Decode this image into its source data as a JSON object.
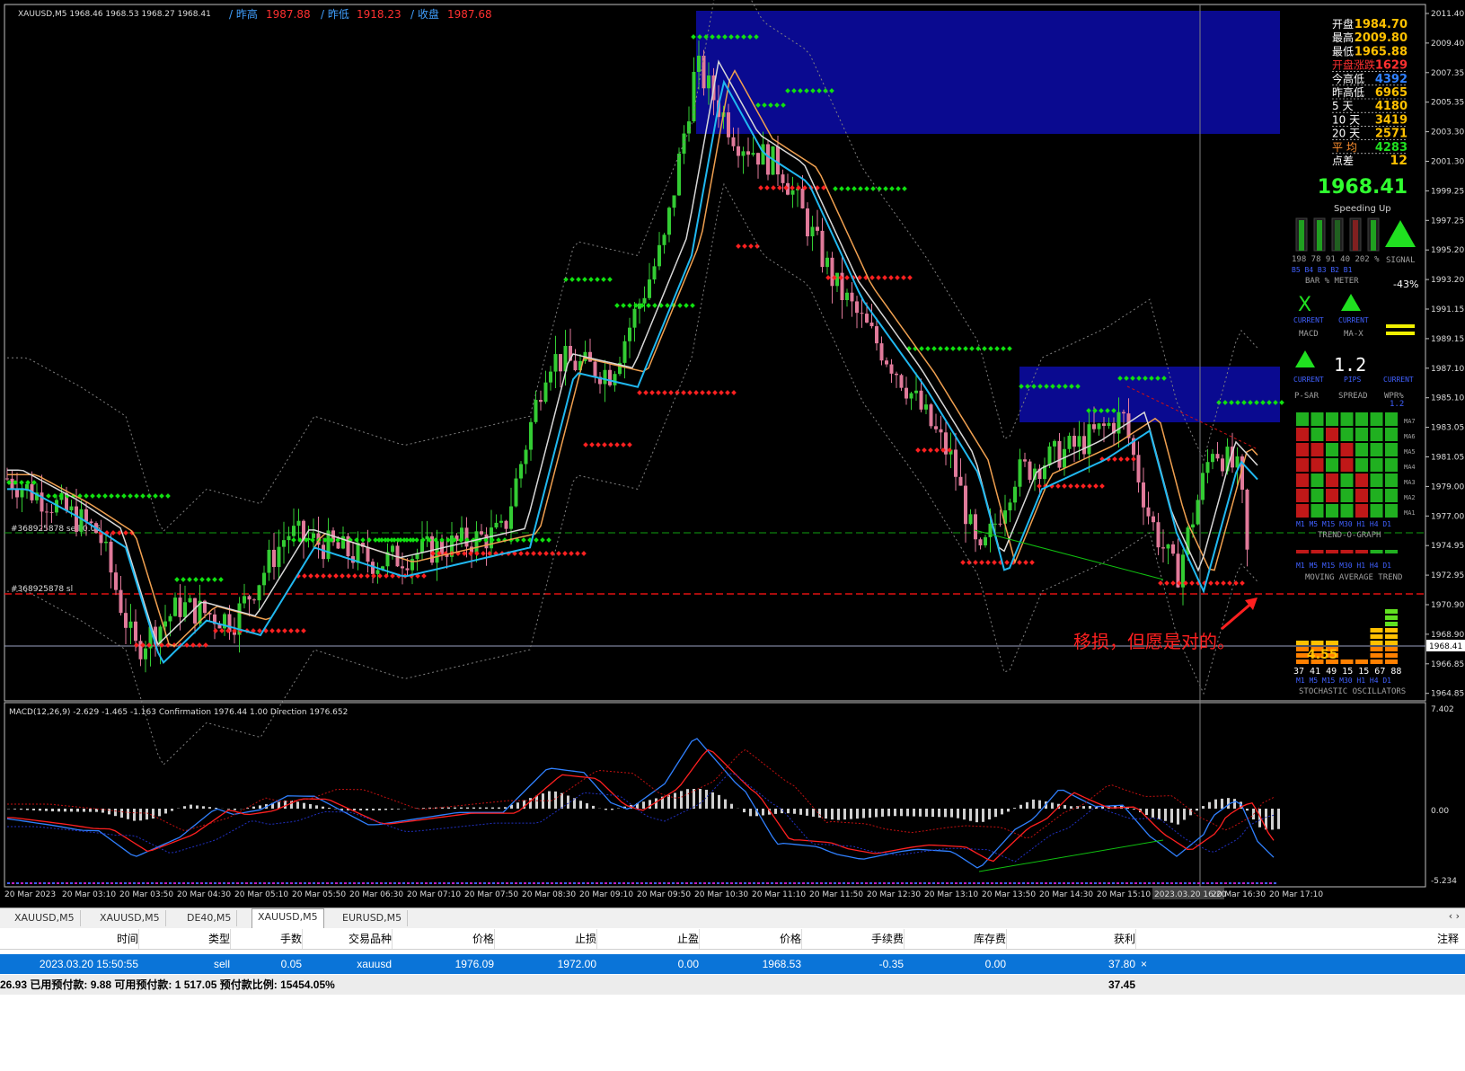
{
  "chart": {
    "symbol_info": "XAUUSD,M5  1968.46 1968.53 1968.27 1968.41",
    "prev_high_label": "/ 昨高",
    "prev_high_value": "1987.88",
    "prev_low_label": "/ 昨低",
    "prev_low_value": "1918.23",
    "close_label": "/ 收盘",
    "close_value": "1987.68",
    "colors": {
      "bull": "#33cc33",
      "bear": "#e07a9a",
      "ma_white": "#d8d8d8",
      "ma_orange": "#f0a050",
      "ma_cyan": "#20b8f0",
      "blue_zone": "#0a0a90",
      "red_dot": "#ff2020",
      "green_dot": "#10e010"
    },
    "price_scale": [
      "2011.40",
      "2009.40",
      "2007.35",
      "2005.35",
      "2003.30",
      "2001.30",
      "1999.25",
      "1997.25",
      "1995.20",
      "1993.20",
      "1991.15",
      "1989.15",
      "1987.10",
      "1985.10",
      "1983.05",
      "1981.05",
      "1979.00",
      "1977.00",
      "1974.95",
      "1972.95",
      "1970.90",
      "1968.90",
      "1966.85",
      "1964.85"
    ],
    "current_price_tag": "1968.41",
    "sl_line_label": "#368925878 sl",
    "sell_line_label": "#368925878 sell 0.05",
    "annotation": "移损，但愿是对的。",
    "time_axis": [
      "20 Mar 2023",
      "20 Mar 03:10",
      "20 Mar 03:50",
      "20 Mar 04:30",
      "20 Mar 05:10",
      "20 Mar 05:50",
      "20 Mar 06:30",
      "20 Mar 07:10",
      "20 Mar 07:50",
      "20 Mar 08:30",
      "20 Mar 09:10",
      "20 Mar 09:50",
      "20 Mar 10:30",
      "20 Mar 11:10",
      "20 Mar 11:50",
      "20 Mar 12:30",
      "20 Mar 13:10",
      "20 Mar 13:50",
      "20 Mar 14:30",
      "20 Mar 15:10",
      "2023.03.20 16:20",
      "20 Mar 16:30",
      "20 Mar 17:10"
    ],
    "macd_label": "MACD(12,26,9) -2.629 -1.465 -1.163  Confirmation 1976.44 1.00  Direction 1976.652",
    "macd_scale": [
      "7.402",
      "0.00",
      "-5.234"
    ]
  },
  "info_panel": {
    "rows": [
      {
        "label": "开盘",
        "value": "1984.70"
      },
      {
        "label": "最高",
        "value": "2009.80"
      },
      {
        "label": "最低",
        "value": "1965.88"
      },
      {
        "label": "开盘涨跌",
        "value": "1629"
      },
      {
        "label": "今高低",
        "value": "4392"
      },
      {
        "label": "昨高低",
        "value": "6965"
      },
      {
        "label": "5  天",
        "value": "4180"
      },
      {
        "label": "10 天",
        "value": "3419"
      },
      {
        "label": "20 天",
        "value": "2571"
      },
      {
        "label": "平  均",
        "value": "4283"
      },
      {
        "label": "点差",
        "value": "12"
      }
    ],
    "big_price": "1968.41",
    "speeding": "Speeding Up",
    "bar_nums": "198 78 91 40 202 %",
    "bar_tf": "B5  B4  B3  B2  B1",
    "bar_meter": "BAR % METER",
    "signal": "SIGNAL",
    "pct": "-43%",
    "current": "CURRENT",
    "macd": "MACD",
    "max": "MA-X",
    "spread_val": "1.2",
    "pips": "PIPS",
    "psar": "P-SAR",
    "spread": "SPREAD",
    "wpr": "WPR%",
    "ma_labels": [
      "MA7",
      "MA6",
      "MA5",
      "MA4",
      "MA3",
      "MA2",
      "MA1"
    ],
    "tf_labels": "M1 M5 M15 M30 H1 H4 D1",
    "trend_graph": "TREND-O-GRAPH",
    "ma_trend": "MOVING AVERAGE TREND",
    "stoch_val": "4.55",
    "stoch_nums": "37  41  49  15  15  67  88",
    "stoch_label": "STOCHASTIC OSCILLATORS",
    "x_mark": "X",
    "wpr_val": "1.2"
  },
  "tabs": [
    "XAUUSD,M5",
    "XAUUSD,M5",
    "DE40,M5",
    "XAUUSD,M5",
    "EURUSD,M5"
  ],
  "active_tab": 3,
  "tab_arrows": "‹  ›",
  "table": {
    "headers": [
      "时间",
      "类型",
      "手数",
      "交易品种",
      "价格",
      "止损",
      "止盈",
      "价格",
      "手续费",
      "库存费",
      "获利",
      "注释"
    ],
    "row": [
      "2023.03.20 15:50:55",
      "sell",
      "0.05",
      "xauusd",
      "1976.09",
      "1972.00",
      "0.00",
      "1968.53",
      "-0.35",
      "0.00",
      "37.80"
    ],
    "close_icon": "×",
    "footer": "26.93  已用预付款: 9.88  可用预付款: 1 517.05  预付款比例: 15454.05%",
    "footer_profit": "37.45"
  }
}
